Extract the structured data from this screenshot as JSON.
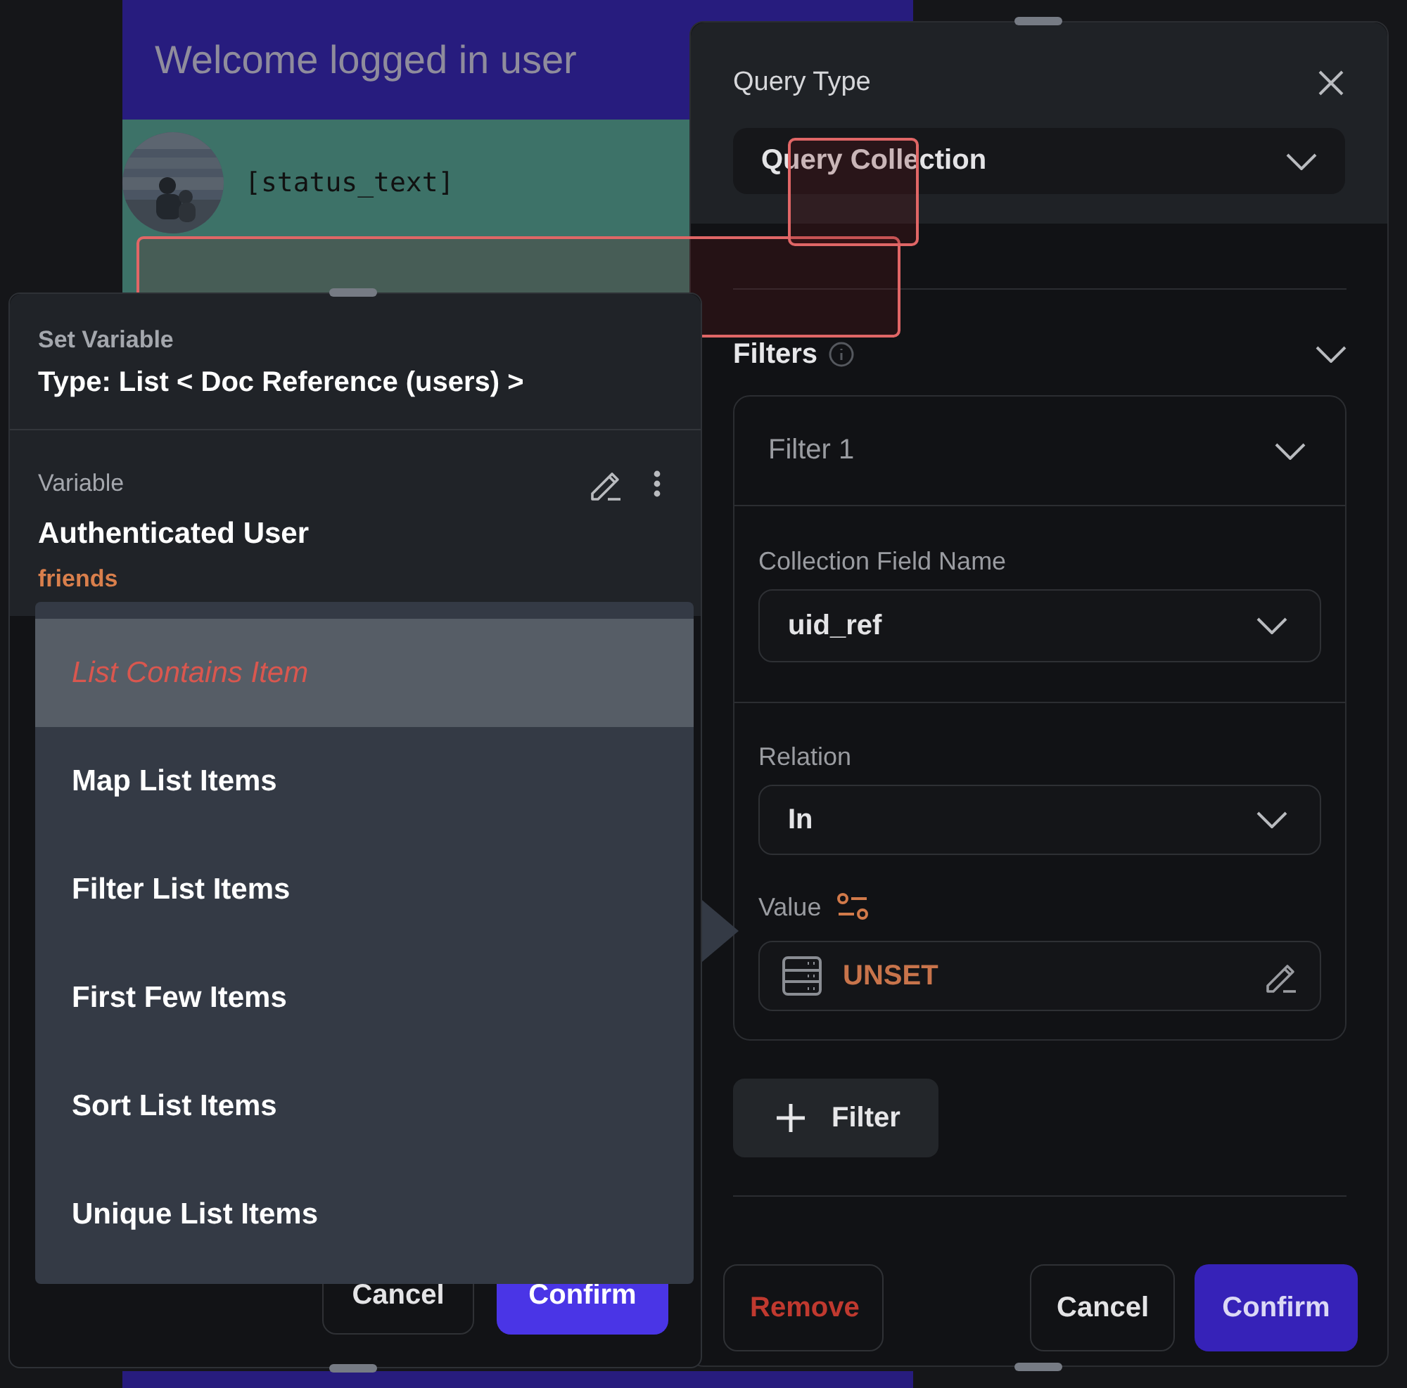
{
  "app_preview": {
    "title": "Welcome logged in user",
    "status_text": "[status_text]"
  },
  "set_variable_panel": {
    "heading": "Set Variable",
    "type": "Type: List < Doc Reference (users) >",
    "variable_label": "Variable",
    "variable_name": "Authenticated User",
    "field": "friends",
    "buttons": [
      {
        "label": "Cancel",
        "kind": "secondary"
      },
      {
        "label": "Confirm",
        "kind": "primary"
      }
    ]
  },
  "operation_menu": {
    "items": [
      {
        "label": "List Contains Item",
        "selected": true
      },
      {
        "label": "Map List Items",
        "selected": false
      },
      {
        "label": "Filter List Items",
        "selected": false
      },
      {
        "label": "First Few Items",
        "selected": false
      },
      {
        "label": "Sort List Items",
        "selected": false
      },
      {
        "label": "Unique List Items",
        "selected": false
      }
    ]
  },
  "query_panel": {
    "title": "Query Type",
    "query_type": "Query Collection",
    "filters_label": "Filters",
    "filters": [
      {
        "title": "Filter 1",
        "field_label": "Collection Field Name",
        "field_value": "uid_ref",
        "relation_label": "Relation",
        "relation_value": "In",
        "value_label": "Value",
        "value": "UNSET"
      }
    ],
    "add_filter_button": "Filter",
    "buttons": [
      {
        "label": "Remove",
        "kind": "danger"
      },
      {
        "label": "Cancel",
        "kind": "secondary"
      },
      {
        "label": "Confirm",
        "kind": "primary"
      }
    ]
  }
}
